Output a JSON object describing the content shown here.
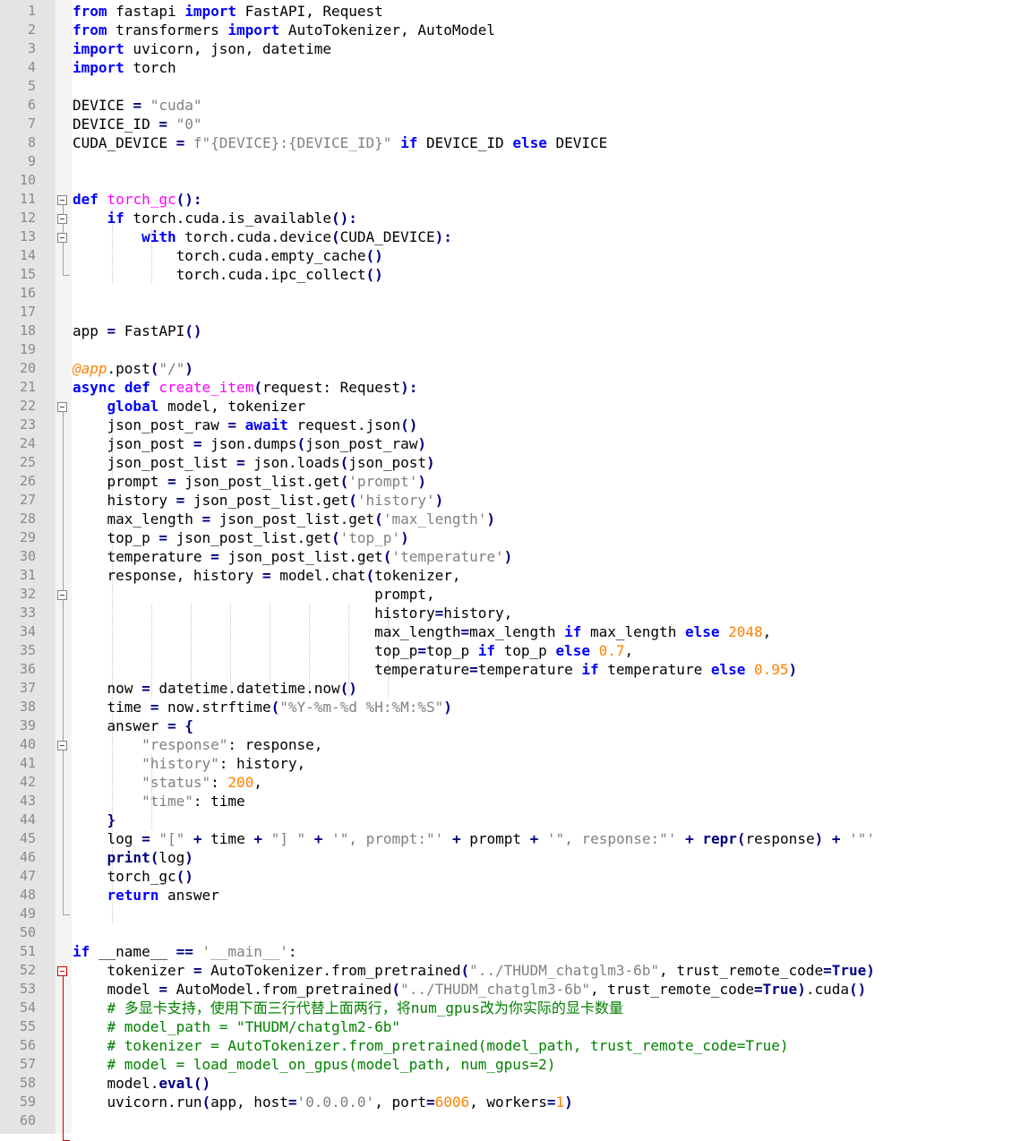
{
  "editor": {
    "language": "python",
    "current_line": 61,
    "colors": {
      "keyword": "#0000ff",
      "string": "#808080",
      "number": "#ff8000",
      "comment": "#008000",
      "function_def": "#ff00ff",
      "decorator": "#ff8000",
      "operator": "#000080",
      "current_line_bg": "#e8e8ff",
      "gutter_bg": "#e4e4e4"
    }
  },
  "lines": [
    [
      [
        "k",
        "from"
      ],
      [
        "p",
        " fastapi "
      ],
      [
        "k",
        "import"
      ],
      [
        "p",
        " FastAPI, Request"
      ]
    ],
    [
      [
        "k",
        "from"
      ],
      [
        "p",
        " transformers "
      ],
      [
        "k",
        "import"
      ],
      [
        "p",
        " AutoTokenizer, AutoModel"
      ]
    ],
    [
      [
        "k",
        "import"
      ],
      [
        "p",
        " uvicorn, json, datetime"
      ]
    ],
    [
      [
        "k",
        "import"
      ],
      [
        "p",
        " torch"
      ]
    ],
    [],
    [
      [
        "p",
        "DEVICE "
      ],
      [
        "o",
        "="
      ],
      [
        "p",
        " "
      ],
      [
        "s",
        "\"cuda\""
      ]
    ],
    [
      [
        "p",
        "DEVICE_ID "
      ],
      [
        "o",
        "="
      ],
      [
        "p",
        " "
      ],
      [
        "s",
        "\"0\""
      ]
    ],
    [
      [
        "p",
        "CUDA_DEVICE "
      ],
      [
        "o",
        "="
      ],
      [
        "p",
        " "
      ],
      [
        "s",
        "f\"{DEVICE}:{DEVICE_ID}\""
      ],
      [
        "p",
        " "
      ],
      [
        "k",
        "if"
      ],
      [
        "p",
        " DEVICE_ID "
      ],
      [
        "k",
        "else"
      ],
      [
        "p",
        " DEVICE"
      ]
    ],
    [],
    [],
    [
      [
        "k",
        "def"
      ],
      [
        "p",
        " "
      ],
      [
        "f",
        "torch_gc"
      ],
      [
        "o",
        "():"
      ]
    ],
    [
      [
        "p",
        "    "
      ],
      [
        "k",
        "if"
      ],
      [
        "p",
        " torch.cuda.is_available"
      ],
      [
        "o",
        "():"
      ]
    ],
    [
      [
        "p",
        "        "
      ],
      [
        "k",
        "with"
      ],
      [
        "p",
        " torch.cuda.device"
      ],
      [
        "o",
        "("
      ],
      [
        "p",
        "CUDA_DEVICE"
      ],
      [
        "o",
        "):"
      ]
    ],
    [
      [
        "p",
        "            torch.cuda.empty_cache"
      ],
      [
        "o",
        "()"
      ]
    ],
    [
      [
        "p",
        "            torch.cuda.ipc_collect"
      ],
      [
        "o",
        "()"
      ]
    ],
    [],
    [],
    [
      [
        "p",
        "app "
      ],
      [
        "o",
        "="
      ],
      [
        "p",
        " FastAPI"
      ],
      [
        "o",
        "()"
      ]
    ],
    [],
    [
      [
        "d",
        "@app"
      ],
      [
        "p",
        ".post"
      ],
      [
        "o",
        "("
      ],
      [
        "s",
        "\"/\""
      ],
      [
        "o",
        ")"
      ]
    ],
    [
      [
        "k",
        "async"
      ],
      [
        "p",
        " "
      ],
      [
        "k",
        "def"
      ],
      [
        "p",
        " "
      ],
      [
        "f",
        "create_item"
      ],
      [
        "o",
        "("
      ],
      [
        "p",
        "request: Request"
      ],
      [
        "o",
        "):"
      ]
    ],
    [
      [
        "p",
        "    "
      ],
      [
        "k",
        "global"
      ],
      [
        "p",
        " model, tokenizer"
      ]
    ],
    [
      [
        "p",
        "    json_post_raw "
      ],
      [
        "o",
        "="
      ],
      [
        "p",
        " "
      ],
      [
        "k",
        "await"
      ],
      [
        "p",
        " request.json"
      ],
      [
        "o",
        "()"
      ]
    ],
    [
      [
        "p",
        "    json_post "
      ],
      [
        "o",
        "="
      ],
      [
        "p",
        " json.dumps"
      ],
      [
        "o",
        "("
      ],
      [
        "p",
        "json_post_raw"
      ],
      [
        "o",
        ")"
      ]
    ],
    [
      [
        "p",
        "    json_post_list "
      ],
      [
        "o",
        "="
      ],
      [
        "p",
        " json.loads"
      ],
      [
        "o",
        "("
      ],
      [
        "p",
        "json_post"
      ],
      [
        "o",
        ")"
      ]
    ],
    [
      [
        "p",
        "    prompt "
      ],
      [
        "o",
        "="
      ],
      [
        "p",
        " json_post_list.get"
      ],
      [
        "o",
        "("
      ],
      [
        "s",
        "'prompt'"
      ],
      [
        "o",
        ")"
      ]
    ],
    [
      [
        "p",
        "    history "
      ],
      [
        "o",
        "="
      ],
      [
        "p",
        " json_post_list.get"
      ],
      [
        "o",
        "("
      ],
      [
        "s",
        "'history'"
      ],
      [
        "o",
        ")"
      ]
    ],
    [
      [
        "p",
        "    max_length "
      ],
      [
        "o",
        "="
      ],
      [
        "p",
        " json_post_list.get"
      ],
      [
        "o",
        "("
      ],
      [
        "s",
        "'max_length'"
      ],
      [
        "o",
        ")"
      ]
    ],
    [
      [
        "p",
        "    top_p "
      ],
      [
        "o",
        "="
      ],
      [
        "p",
        " json_post_list.get"
      ],
      [
        "o",
        "("
      ],
      [
        "s",
        "'top_p'"
      ],
      [
        "o",
        ")"
      ]
    ],
    [
      [
        "p",
        "    temperature "
      ],
      [
        "o",
        "="
      ],
      [
        "p",
        " json_post_list.get"
      ],
      [
        "o",
        "("
      ],
      [
        "s",
        "'temperature'"
      ],
      [
        "o",
        ")"
      ]
    ],
    [
      [
        "p",
        "    response, history "
      ],
      [
        "o",
        "="
      ],
      [
        "p",
        " model.chat"
      ],
      [
        "o",
        "("
      ],
      [
        "p",
        "tokenizer,"
      ]
    ],
    [
      [
        "p",
        "                                   prompt,"
      ]
    ],
    [
      [
        "p",
        "                                   history"
      ],
      [
        "o",
        "="
      ],
      [
        "p",
        "history,"
      ]
    ],
    [
      [
        "p",
        "                                   max_length"
      ],
      [
        "o",
        "="
      ],
      [
        "p",
        "max_length "
      ],
      [
        "k",
        "if"
      ],
      [
        "p",
        " max_length "
      ],
      [
        "k",
        "else"
      ],
      [
        "p",
        " "
      ],
      [
        "n",
        "2048"
      ],
      [
        "p",
        ","
      ]
    ],
    [
      [
        "p",
        "                                   top_p"
      ],
      [
        "o",
        "="
      ],
      [
        "p",
        "top_p "
      ],
      [
        "k",
        "if"
      ],
      [
        "p",
        " top_p "
      ],
      [
        "k",
        "else"
      ],
      [
        "p",
        " "
      ],
      [
        "n",
        "0.7"
      ],
      [
        "p",
        ","
      ]
    ],
    [
      [
        "p",
        "                                   temperature"
      ],
      [
        "o",
        "="
      ],
      [
        "p",
        "temperature "
      ],
      [
        "k",
        "if"
      ],
      [
        "p",
        " temperature "
      ],
      [
        "k",
        "else"
      ],
      [
        "p",
        " "
      ],
      [
        "n",
        "0.95"
      ],
      [
        "o",
        ")"
      ]
    ],
    [
      [
        "p",
        "    now "
      ],
      [
        "o",
        "="
      ],
      [
        "p",
        " datetime.datetime.now"
      ],
      [
        "o",
        "()"
      ]
    ],
    [
      [
        "p",
        "    time "
      ],
      [
        "o",
        "="
      ],
      [
        "p",
        " now.strftime"
      ],
      [
        "o",
        "("
      ],
      [
        "s",
        "\"%Y-%m-%d %H:%M:%S\""
      ],
      [
        "o",
        ")"
      ]
    ],
    [
      [
        "p",
        "    answer "
      ],
      [
        "o",
        "="
      ],
      [
        "p",
        " "
      ],
      [
        "o",
        "{"
      ]
    ],
    [
      [
        "p",
        "        "
      ],
      [
        "s",
        "\"response\""
      ],
      [
        "p",
        ": response,"
      ]
    ],
    [
      [
        "p",
        "        "
      ],
      [
        "s",
        "\"history\""
      ],
      [
        "p",
        ": history,"
      ]
    ],
    [
      [
        "p",
        "        "
      ],
      [
        "s",
        "\"status\""
      ],
      [
        "p",
        ": "
      ],
      [
        "n",
        "200"
      ],
      [
        "p",
        ","
      ]
    ],
    [
      [
        "p",
        "        "
      ],
      [
        "s",
        "\"time\""
      ],
      [
        "p",
        ": time"
      ]
    ],
    [
      [
        "p",
        "    "
      ],
      [
        "o",
        "}"
      ]
    ],
    [
      [
        "p",
        "    log "
      ],
      [
        "o",
        "="
      ],
      [
        "p",
        " "
      ],
      [
        "s",
        "\"[\""
      ],
      [
        "p",
        " "
      ],
      [
        "o",
        "+"
      ],
      [
        "p",
        " time "
      ],
      [
        "o",
        "+"
      ],
      [
        "p",
        " "
      ],
      [
        "s",
        "\"] \""
      ],
      [
        "p",
        " "
      ],
      [
        "o",
        "+"
      ],
      [
        "p",
        " "
      ],
      [
        "s",
        "'\", prompt:\"'"
      ],
      [
        "p",
        " "
      ],
      [
        "o",
        "+"
      ],
      [
        "p",
        " prompt "
      ],
      [
        "o",
        "+"
      ],
      [
        "p",
        " "
      ],
      [
        "s",
        "'\", response:\"'"
      ],
      [
        "p",
        " "
      ],
      [
        "o",
        "+"
      ],
      [
        "p",
        " "
      ],
      [
        "bi",
        "repr"
      ],
      [
        "o",
        "("
      ],
      [
        "p",
        "response"
      ],
      [
        "o",
        ")"
      ],
      [
        "p",
        " "
      ],
      [
        "o",
        "+"
      ],
      [
        "p",
        " "
      ],
      [
        "s",
        "'\"'"
      ]
    ],
    [
      [
        "p",
        "    "
      ],
      [
        "bi",
        "print"
      ],
      [
        "o",
        "("
      ],
      [
        "p",
        "log"
      ],
      [
        "o",
        ")"
      ]
    ],
    [
      [
        "p",
        "    torch_gc"
      ],
      [
        "o",
        "()"
      ]
    ],
    [
      [
        "p",
        "    "
      ],
      [
        "k",
        "return"
      ],
      [
        "p",
        " answer"
      ]
    ],
    [],
    [],
    [
      [
        "k",
        "if"
      ],
      [
        "p",
        " __name__ "
      ],
      [
        "o",
        "=="
      ],
      [
        "p",
        " "
      ],
      [
        "s",
        "'__main__'"
      ],
      [
        "p",
        ":"
      ]
    ],
    [
      [
        "p",
        "    tokenizer "
      ],
      [
        "o",
        "="
      ],
      [
        "p",
        " AutoTokenizer.from_pretrained"
      ],
      [
        "o",
        "("
      ],
      [
        "s",
        "\"../THUDM_chatglm3-6b\""
      ],
      [
        "p",
        ", trust_remote_code"
      ],
      [
        "o",
        "="
      ],
      [
        "bi",
        "True"
      ],
      [
        "o",
        ")"
      ]
    ],
    [
      [
        "p",
        "    model "
      ],
      [
        "o",
        "="
      ],
      [
        "p",
        " AutoModel.from_pretrained"
      ],
      [
        "o",
        "("
      ],
      [
        "s",
        "\"../THUDM_chatglm3-6b\""
      ],
      [
        "p",
        ", trust_remote_code"
      ],
      [
        "o",
        "="
      ],
      [
        "bi",
        "True"
      ],
      [
        "o",
        ")"
      ],
      [
        "p",
        ".cuda"
      ],
      [
        "o",
        "()"
      ]
    ],
    [
      [
        "p",
        "    "
      ],
      [
        "c",
        "# 多显卡支持，使用下面三行代替上面两行，将num_gpus改为你实际的显卡数量"
      ]
    ],
    [
      [
        "p",
        "    "
      ],
      [
        "c",
        "# model_path = \"THUDM/chatglm2-6b\""
      ]
    ],
    [
      [
        "p",
        "    "
      ],
      [
        "c",
        "# tokenizer = AutoTokenizer.from_pretrained(model_path, trust_remote_code=True)"
      ]
    ],
    [
      [
        "p",
        "    "
      ],
      [
        "c",
        "# model = load_model_on_gpus(model_path, num_gpus=2)"
      ]
    ],
    [
      [
        "p",
        "    model."
      ],
      [
        "bi",
        "eval"
      ],
      [
        "o",
        "()"
      ]
    ],
    [
      [
        "p",
        "    uvicorn.run"
      ],
      [
        "o",
        "("
      ],
      [
        "p",
        "app, host"
      ],
      [
        "o",
        "="
      ],
      [
        "s",
        "'0.0.0.0'"
      ],
      [
        "p",
        ", port"
      ],
      [
        "o",
        "="
      ],
      [
        "n",
        "6006"
      ],
      [
        "p",
        ", workers"
      ],
      [
        "o",
        "="
      ],
      [
        "n",
        "1"
      ],
      [
        "o",
        ")"
      ]
    ],
    []
  ]
}
